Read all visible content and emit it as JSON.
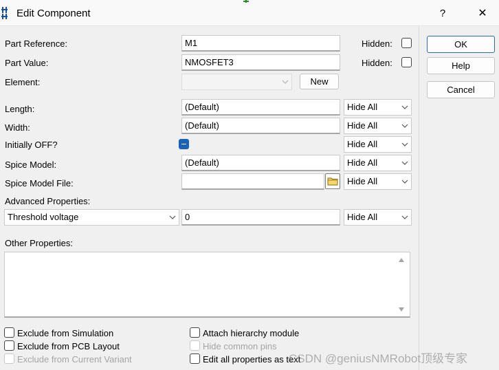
{
  "window": {
    "title": "Edit Component",
    "help_glyph": "?",
    "close_glyph": "✕"
  },
  "part_reference": {
    "label": "Part Reference:",
    "value": "M1",
    "hidden_label": "Hidden:"
  },
  "part_value": {
    "label": "Part Value:",
    "value": "NMOSFET3",
    "hidden_label": "Hidden:"
  },
  "element": {
    "label": "Element:",
    "value": "",
    "new_button": "New"
  },
  "properties": [
    {
      "label": "Length:",
      "value": "(Default)",
      "visibility": "Hide All"
    },
    {
      "label": "Width:",
      "value": "(Default)",
      "visibility": "Hide All"
    },
    {
      "label": "Initially OFF?",
      "value": "",
      "visibility": "Hide All"
    },
    {
      "label": "Spice Model:",
      "value": "(Default)",
      "visibility": "Hide All"
    },
    {
      "label": "Spice Model File:",
      "value": "",
      "visibility": "Hide All"
    }
  ],
  "advanced": {
    "label": "Advanced Properties:",
    "property": "Threshold voltage",
    "value": "0",
    "visibility": "Hide All"
  },
  "other_properties": {
    "label": "Other Properties:",
    "text": ""
  },
  "buttons": {
    "ok": "OK",
    "help": "Help",
    "cancel": "Cancel"
  },
  "checkboxes": {
    "exclude_simulation": "Exclude from Simulation",
    "exclude_pcb": "Exclude from PCB Layout",
    "exclude_variant": "Exclude from Current Variant",
    "attach_hierarchy": "Attach hierarchy module",
    "hide_common_pins": "Hide common pins",
    "edit_all_as_text": "Edit all properties as text"
  },
  "watermark": "CSDN @geniusNMRobot顶级专家",
  "colors": {
    "accent": "#1a62b8",
    "ok_border": "#2e69b5",
    "window_bg": "#f0f0f0"
  }
}
